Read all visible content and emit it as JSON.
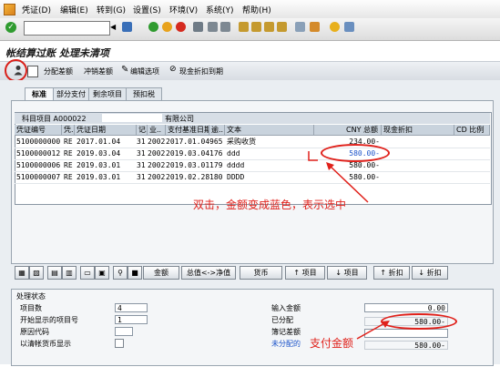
{
  "menu": {
    "items": [
      "凭证(D)",
      "编辑(E)",
      "转到(G)",
      "设置(S)",
      "环境(V)",
      "系统(Y)",
      "帮助(H)"
    ]
  },
  "window": {
    "title": "帐结算过账 处理未清项"
  },
  "app_toolbar": {
    "distribute_diff": "分配差额",
    "offset_diff": "冲销差额",
    "edit_options": "编辑选项",
    "cash_discount_due": "现金折扣到期"
  },
  "tabs": [
    "标准",
    "部分支付",
    "剩余项目",
    "预扣税"
  ],
  "grid": {
    "account_label": "科目项目 A000022",
    "company_suffix": "有限公司",
    "columns": [
      "凭证编号",
      "凭..",
      "凭证日期",
      "记..",
      "业..",
      "支付基准日期",
      "逾..",
      "文本",
      "CNY 总额",
      "现金折扣",
      "CD 比例"
    ],
    "rows": [
      {
        "doc": "5100000000",
        "type": "RE",
        "date": "2017.01.04",
        "pk": "31",
        "ba": "2002",
        "base": "2017.01.04",
        "days": "965",
        "text": "采购收货",
        "amount": "234.00-"
      },
      {
        "doc": "5100000012",
        "type": "RE",
        "date": "2019.03.04",
        "pk": "31",
        "ba": "2002",
        "base": "2019.03.04",
        "days": "176",
        "text": "ddd",
        "amount": "580.00-"
      },
      {
        "doc": "5100000006",
        "type": "RE",
        "date": "2019.03.01",
        "pk": "31",
        "ba": "2002",
        "base": "2019.03.01",
        "days": "179",
        "text": "dddd",
        "amount": "580.00-"
      },
      {
        "doc": "5100000007",
        "type": "RE",
        "date": "2019.03.01",
        "pk": "31",
        "ba": "2002",
        "base": "2019.02.28",
        "days": "180",
        "text": "DDDD",
        "amount": "580.00-"
      }
    ]
  },
  "annotations": {
    "double_click": "双击，金额变成蓝色，表示选中",
    "payment_amount": "支付金额"
  },
  "buttons": {
    "amount": "金额",
    "gross_net": "总值<->净值",
    "currency": "货币",
    "item1": "项目",
    "item2": "项目",
    "discount1": "折扣",
    "discount2": "折扣"
  },
  "status": {
    "section_title": "处理状态",
    "item_count_label": "项目数",
    "item_count_value": "4",
    "start_item_label": "开始显示的项目号",
    "start_item_value": "1",
    "reason_code_label": "原因代码",
    "display_in_clearing_label": "以清帐货币显示",
    "input_amount_label": "输入金额",
    "input_amount_value": "0.00",
    "assigned_label": "已分配",
    "assigned_value": "580.00-",
    "note_diff_label": "簿记差额",
    "unassigned_label": "未分配的",
    "unassigned_value": "580.00-"
  },
  "colors": {
    "annotation_red": "#e0211b",
    "selected_blue": "#1a52c9"
  }
}
